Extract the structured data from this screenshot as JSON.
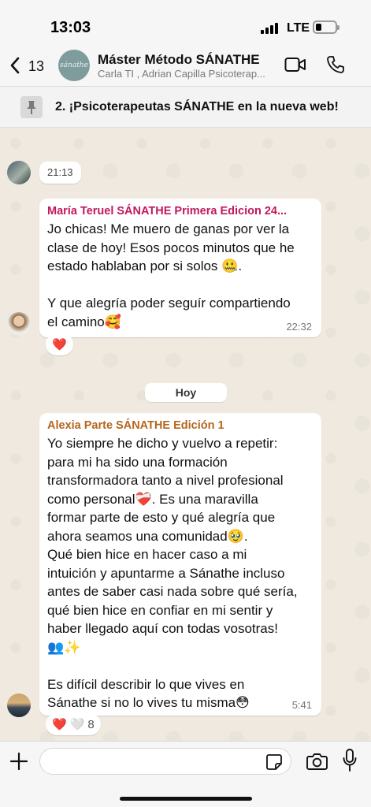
{
  "status": {
    "time": "13:03",
    "network": "LTE"
  },
  "header": {
    "back_count": "13",
    "avatar_text": "sánathe",
    "title": "Máster Método SÁNATHE",
    "subtitle": "Carla TI , Adrian Capilla Psicoterap..."
  },
  "pinned": {
    "text": "2. ¡Psicoterapeutas SÁNATHE en la nueva web!"
  },
  "messages": [
    {
      "time": "21:13"
    },
    {
      "sender": "María Teruel SÁNATHE Primera Edicion 24...",
      "sender_color": "#c2185b",
      "text": "Jo chicas! Me muero de ganas por ver la\nclase de hoy! Esos pocos minutos que he\nestado hablaban por si solos 🤐.\n\nY que alegría poder seguír compartiendo\nel camino🥰",
      "time": "22:32",
      "reactions": [
        "❤️"
      ]
    },
    {
      "sender": "Alexia Parte SÁNATHE Edición 1",
      "sender_color": "#b5651d",
      "text": "Yo siempre he dicho y vuelvo a repetir:\npara mi ha sido una formación\ntransformadora tanto a nivel profesional\ncomo personal❤️‍🩹. Es una maravilla\nformar parte de esto y qué alegría que\nahora seamos una comunidad🥹.\nQué bien hice en hacer caso a mi\nintuición y apuntarme a Sánathe incluso\nantes de saber casi nada sobre qué sería,\nqué bien hice en confiar en mi sentir y\nhaber llegado aquí con todas vosotras!\n👥✨\n\nEs difícil describir lo que vives en\nSánathe si no lo vives tu misma😳",
      "time": "5:41",
      "reactions": [
        "❤️",
        "🤍"
      ],
      "reaction_count": "8"
    }
  ],
  "day_separator": "Hoy",
  "input": {
    "placeholder": ""
  }
}
